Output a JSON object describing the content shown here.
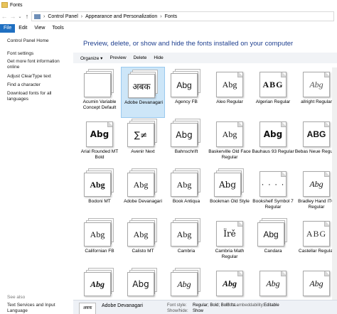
{
  "window": {
    "title": "Fonts"
  },
  "address": {
    "nav_back": "←",
    "nav_forward": "→",
    "nav_recent": "⌄",
    "nav_up": "↑",
    "crumbs": [
      "Control Panel",
      "Appearance and Personalization",
      "Fonts"
    ],
    "separator": "›"
  },
  "menu": {
    "items": [
      "File",
      "Edit",
      "View",
      "Tools"
    ]
  },
  "sidebar": {
    "links": [
      "Control Panel Home",
      "Font settings",
      "Get more font information online",
      "Adjust ClearType text",
      "Find a character",
      "Download fonts for all languages"
    ],
    "see_also": "See also",
    "see_also_links": [
      "Text Services and Input Language"
    ]
  },
  "main": {
    "heading": "Preview, delete, or show and hide the fonts installed on your computer"
  },
  "commands": {
    "organize": "Organize ▾",
    "preview": "Preview",
    "delete": "Delete",
    "hide": "Hide"
  },
  "fonts": [
    {
      "name": "Acumin Variable Concept Default",
      "sample": "",
      "stack": true
    },
    {
      "name": "Adobe Devanagari",
      "sample": "अबक",
      "stack": true,
      "selected": true
    },
    {
      "name": "Agency FB",
      "sample": "Abg",
      "stack": true
    },
    {
      "name": "Aleo Regular",
      "sample": "Abg",
      "stack": false
    },
    {
      "name": "Algerian Regular",
      "sample": "ABG",
      "stack": false
    },
    {
      "name": "allright Regular",
      "sample": "Abg",
      "stack": false
    },
    {
      "name": "Arial Rounded MT Bold",
      "sample": "Abg",
      "stack": false
    },
    {
      "name": "Avenir Next",
      "sample": "∑≠",
      "stack": true
    },
    {
      "name": "Bahnschrift",
      "sample": "Abg",
      "stack": true
    },
    {
      "name": "Baskerville Old Face Regular",
      "sample": "Abg",
      "stack": false
    },
    {
      "name": "Bauhaus 93 Regular",
      "sample": "Abg",
      "stack": false
    },
    {
      "name": "Bebas Neue Regular",
      "sample": "ABG",
      "stack": false
    },
    {
      "name": "Bodoni MT",
      "sample": "Abg",
      "stack": true
    },
    {
      "name": "Adobe Devanagari",
      "sample": "Abg",
      "stack": true
    },
    {
      "name": "Book Antiqua",
      "sample": "Abg",
      "stack": true
    },
    {
      "name": "Bookman Old Style",
      "sample": "Abg",
      "stack": true
    },
    {
      "name": "Bookshelf Symbol 7 Regular",
      "sample": "· · · ·",
      "stack": false
    },
    {
      "name": "Bradley Hand ITC Regular",
      "sample": "Abg",
      "stack": false
    },
    {
      "name": "Californian FB",
      "sample": "Abg",
      "stack": true
    },
    {
      "name": "Calisto MT",
      "sample": "Abg",
      "stack": true
    },
    {
      "name": "Cambria",
      "sample": "Abg",
      "stack": true
    },
    {
      "name": "Cambria Math Regular",
      "sample": "Ïrě",
      "stack": false
    },
    {
      "name": "Candara",
      "sample": "Abg",
      "stack": true
    },
    {
      "name": "Castellar Regular",
      "sample": "ABG",
      "stack": false
    },
    {
      "name": "",
      "sample": "Abg",
      "stack": true
    },
    {
      "name": "",
      "sample": "Abg",
      "stack": true
    },
    {
      "name": "",
      "sample": "Abg",
      "stack": true
    },
    {
      "name": "",
      "sample": "Abg",
      "stack": false
    },
    {
      "name": "",
      "sample": "Abg",
      "stack": false
    },
    {
      "name": "",
      "sample": "Abg",
      "stack": false
    }
  ],
  "details": {
    "thumb": "अबक",
    "name": "Adobe Devanagari",
    "style_label": "Font style:",
    "style_value": "Regular; Bold; Bold Ita...",
    "embed_label": "Font embeddability:",
    "embed_value": "Editable",
    "showhide_label": "Show/hide:",
    "showhide_value": "Show"
  }
}
